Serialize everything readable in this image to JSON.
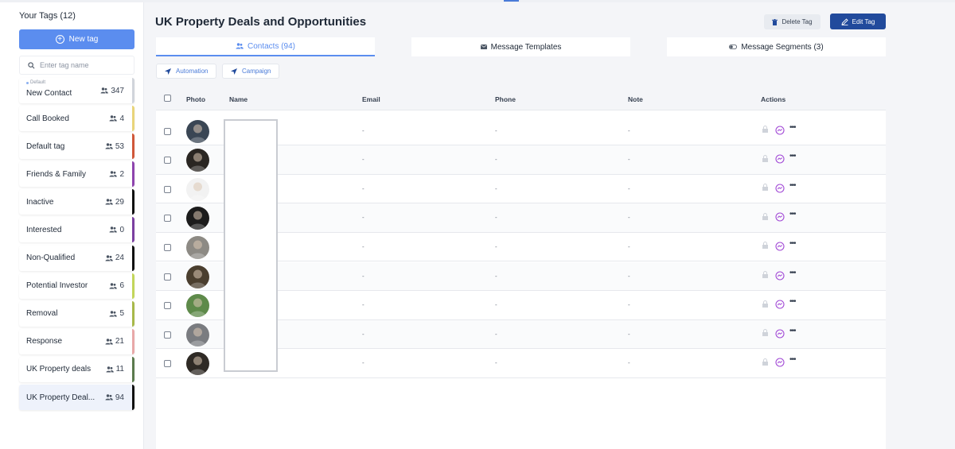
{
  "sidebar": {
    "title": "Your Tags (12)",
    "new_tag_label": "New tag",
    "search_placeholder": "Enter tag name",
    "default_label": "Default",
    "tags": [
      {
        "name": "New Contact",
        "count": "347",
        "color": "#d1d5db",
        "default": true
      },
      {
        "name": "Call Booked",
        "count": "4",
        "color": "#e9d57a"
      },
      {
        "name": "Default tag",
        "count": "53",
        "color": "#d0583a"
      },
      {
        "name": "Friends & Family",
        "count": "2",
        "color": "#8e44ad"
      },
      {
        "name": "Inactive",
        "count": "29",
        "color": "#111111"
      },
      {
        "name": "Interested",
        "count": "0",
        "color": "#7b3fa0"
      },
      {
        "name": "Non-Qualified",
        "count": "24",
        "color": "#111111"
      },
      {
        "name": "Potential Investor",
        "count": "6",
        "color": "#c3d65a"
      },
      {
        "name": "Removal",
        "count": "5",
        "color": "#a8b94a"
      },
      {
        "name": "Response",
        "count": "21",
        "color": "#e8a8a8"
      },
      {
        "name": "UK Property deals",
        "count": "11",
        "color": "#5b7a4d"
      },
      {
        "name": "UK Property Deal...",
        "count": "94",
        "color": "#111111",
        "active": true
      }
    ]
  },
  "header": {
    "title": "UK Property Deals and Opportunities",
    "delete_label": "Delete Tag",
    "edit_label": "Edit Tag"
  },
  "tabs": {
    "contacts": "Contacts (94)",
    "templates": "Message Templates",
    "segments": "Message Segments (3)"
  },
  "chips": {
    "automation": "Automation",
    "campaign": "Campaign"
  },
  "table": {
    "columns": {
      "photo": "Photo",
      "name": "Name",
      "email": "Email",
      "phone": "Phone",
      "note": "Note",
      "actions": "Actions"
    },
    "rows": [
      {
        "email": "-",
        "phone": "-",
        "note": "-",
        "avatar_bg": "#3a4654"
      },
      {
        "email": "-",
        "phone": "-",
        "note": "-",
        "avatar_bg": "#2a2622"
      },
      {
        "email": "-",
        "phone": "-",
        "note": "-",
        "avatar_bg": "#f2f2f2"
      },
      {
        "email": "-",
        "phone": "-",
        "note": "-",
        "avatar_bg": "#1c1c1c"
      },
      {
        "email": "-",
        "phone": "-",
        "note": "-",
        "avatar_bg": "#8d8a84"
      },
      {
        "email": "-",
        "phone": "-",
        "note": "-",
        "avatar_bg": "#4b3f2f"
      },
      {
        "email": "-",
        "phone": "-",
        "note": "-",
        "avatar_bg": "#5e8a4a"
      },
      {
        "email": "-",
        "phone": "-",
        "note": "-",
        "avatar_bg": "#7a7c80"
      },
      {
        "email": "-",
        "phone": "-",
        "note": "-",
        "avatar_bg": "#2f2a25"
      }
    ]
  },
  "colors": {
    "primary": "#5b8def",
    "edit_button": "#214a9c",
    "messenger": "#a24ad6"
  }
}
